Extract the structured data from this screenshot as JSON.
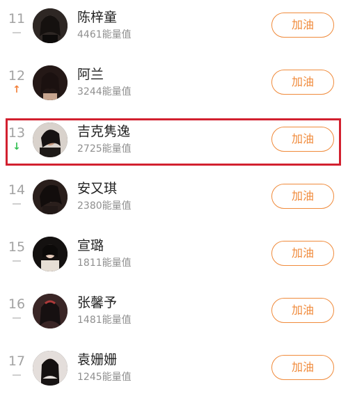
{
  "rankings": [
    {
      "rank": "11",
      "trend": "flat",
      "name": "陈梓童",
      "score": "4461能量值",
      "button": "加油",
      "avatar_tint": "#3a2f2c"
    },
    {
      "rank": "12",
      "trend": "up",
      "trend_symbol": "↑",
      "name": "阿兰",
      "score": "3244能量值",
      "button": "加油",
      "avatar_tint": "#2a1d1a"
    },
    {
      "rank": "13",
      "trend": "down",
      "trend_symbol": "↓",
      "name": "吉克隽逸",
      "score": "2725能量值",
      "button": "加油",
      "avatar_tint": "#2b2623"
    },
    {
      "rank": "14",
      "trend": "flat",
      "name": "安又琪",
      "score": "2380能量值",
      "button": "加油",
      "avatar_tint": "#30231f"
    },
    {
      "rank": "15",
      "trend": "flat",
      "name": "宣璐",
      "score": "1811能量值",
      "button": "加油",
      "avatar_tint": "#1d1815"
    },
    {
      "rank": "16",
      "trend": "flat",
      "name": "张馨予",
      "score": "1481能量值",
      "button": "加油",
      "avatar_tint": "#221c1c"
    },
    {
      "rank": "17",
      "trend": "flat",
      "name": "袁姗姗",
      "score": "1245能量值",
      "button": "加油",
      "avatar_tint": "#1a1716"
    }
  ],
  "colors": {
    "accent": "#f08a3a",
    "up": "#f2803a",
    "down": "#2fbf4f",
    "highlight": "#d2202f"
  },
  "highlighted_rank": "13"
}
